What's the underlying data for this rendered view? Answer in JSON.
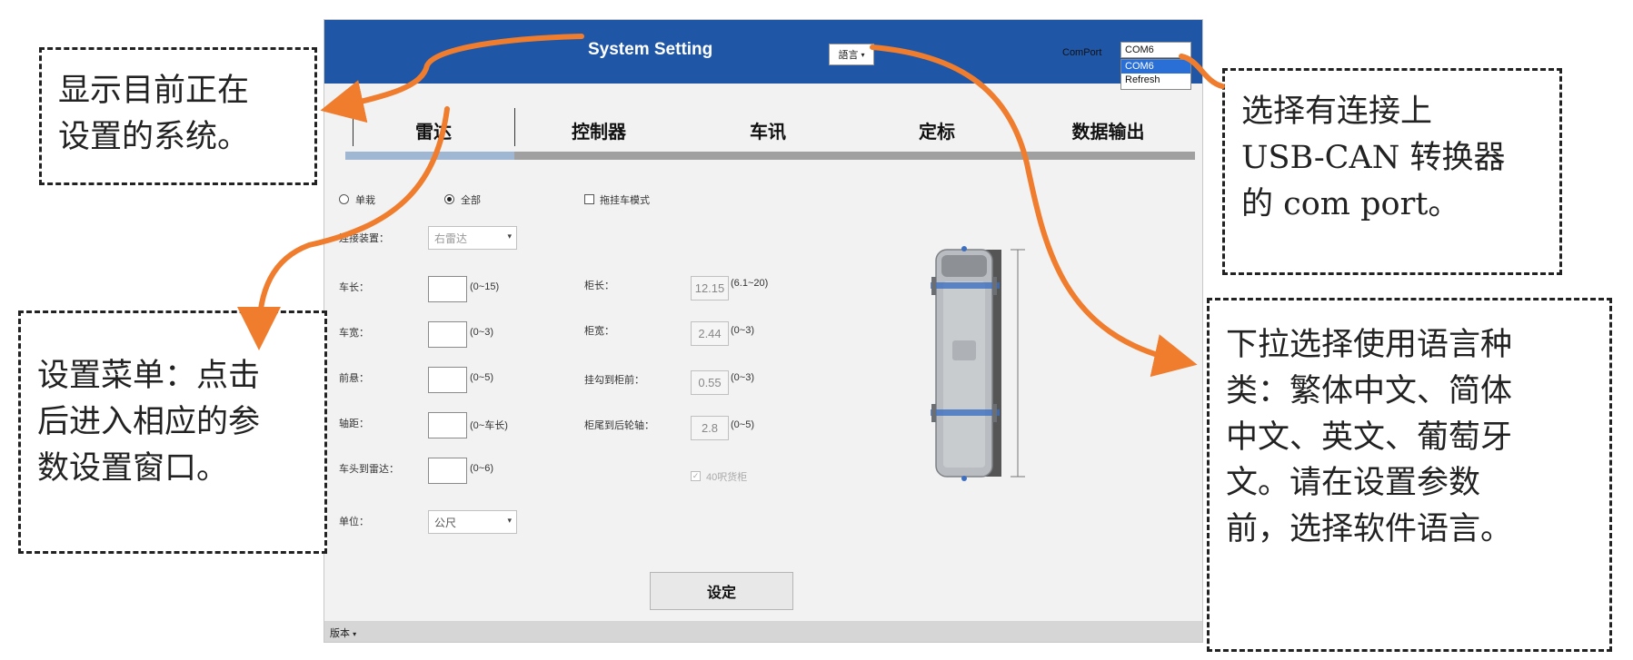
{
  "callouts": {
    "system_display": [
      "显示目前正在",
      "设置的系统。"
    ],
    "settings_menu": [
      "设置菜单：点击",
      "后进入相应的参",
      "数设置窗口。"
    ],
    "com_port": [
      "选择有连接上",
      "USB-CAN 转换器",
      "的 com port。"
    ],
    "language": [
      "下拉选择使用语言种",
      "类：繁体中文、简体",
      "中文、英文、葡萄牙",
      "文。请在设置参数",
      "前，选择软件语言。"
    ]
  },
  "titlebar": {
    "title": "System Setting",
    "language_select": "語言",
    "comport_label": "ComPort",
    "comport_value": "COM6",
    "comport_options": [
      "COM6",
      "Refresh"
    ]
  },
  "tabs": [
    "雷达",
    "控制器",
    "车讯",
    "定标",
    "数据输出"
  ],
  "form": {
    "radio_single": "单栽",
    "radio_all": "全部",
    "trailer_mode": "拖挂车模式",
    "device_label": "连接装置：",
    "device_value": "右雷达",
    "left_fields": [
      {
        "label": "车长：",
        "range": "(0~15)"
      },
      {
        "label": "车宽：",
        "range": "(0~3)"
      },
      {
        "label": "前悬：",
        "range": "(0~5)"
      },
      {
        "label": "轴距：",
        "range": "(0~车长)"
      },
      {
        "label": "车头到雷达：",
        "range": "(0~6)"
      }
    ],
    "right_fields": [
      {
        "label": "柜长：",
        "value": "12.15",
        "range": "(6.1~20)"
      },
      {
        "label": "柜宽：",
        "value": "2.44",
        "range": "(0~3)"
      },
      {
        "label": "挂勾到柜前：",
        "value": "0.55",
        "range": "(0~3)"
      },
      {
        "label": "柜尾到后轮轴：",
        "value": "2.8",
        "range": "(0~5)"
      }
    ],
    "container_40ft": "40呎货柜",
    "unit_label": "单位：",
    "unit_value": "公尺",
    "apply_button": "设定"
  },
  "statusbar": {
    "version": "版本"
  },
  "colors": {
    "titlebar": "#1f56a6",
    "arrow": "#ef7d2d",
    "tab_active": "#9fb7d3"
  }
}
